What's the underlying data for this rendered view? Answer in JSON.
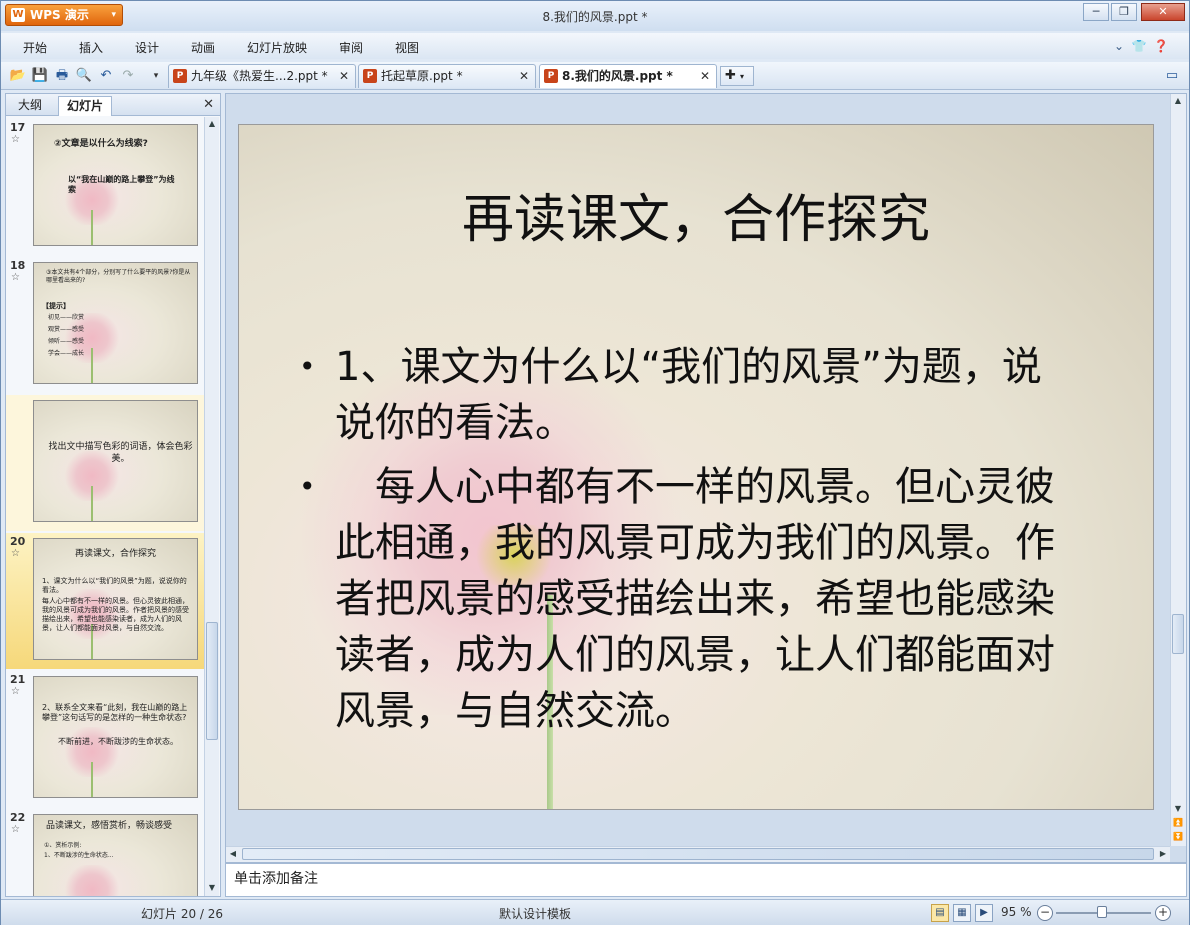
{
  "app": {
    "button_label": "WPS 演示",
    "window_title": "8.我们的风景.ppt *"
  },
  "menu": [
    "开始",
    "插入",
    "设计",
    "动画",
    "幻灯片放映",
    "审阅",
    "视图"
  ],
  "tabs": [
    {
      "label": "九年级《热爱生...2.ppt *"
    },
    {
      "label": "托起草原.ppt *"
    },
    {
      "label": "8.我们的风景.ppt *"
    }
  ],
  "left_pane": {
    "tab_outline": "大纲",
    "tab_slides": "幻灯片",
    "thumbs": [
      {
        "num": "17",
        "lines": [
          "②文章是以什么为线索?",
          "以“我在山巅的路上攀登”为线索"
        ]
      },
      {
        "num": "18",
        "lines": [
          "③本文共有4个部分，分别写了什么要平的风景?你是从哪里看出来的?",
          "【提示】",
          "初见——欣赏",
          "观赏——感受",
          "倾听——感受",
          "学会——成长"
        ]
      },
      {
        "num": "",
        "lines": [
          "找出文中描写色彩的词语，体会色彩美。"
        ]
      },
      {
        "num": "20",
        "lines": [
          "再读课文，合作探究",
          "1、课文为什么以“我们的风景”为题，说说你的看法。",
          "每人心中都有不一样的风景。但心灵彼此相通，我的风景可成为我们的风景。作者把风景的感受描绘出来，希望也能感染读者，成为人们的风景，让人们都能面对风景，与自然交流。"
        ]
      },
      {
        "num": "21",
        "lines": [
          "2、联系全文来看“此刻，我在山巅的路上攀登”这句话写的是怎样的一种生命状态?",
          "不断前进，不断跋涉的生命状态。"
        ]
      },
      {
        "num": "22",
        "lines": [
          "品读课文，感悟赏析，畅谈感受",
          "①、赏析示例:",
          "1、不断跋涉的生命状态..."
        ]
      }
    ]
  },
  "slide": {
    "title": "再读课文，合作探究",
    "bullets": [
      "1、课文为什么以“我们的风景”为题，说说你的看法。",
      "　每人心中都有不一样的风景。但心灵彼此相通，我的风景可成为我们的风景。作者把风景的感受描绘出来，希望也能感染读者，成为人们的风景，让人们都能面对风景，与自然交流。"
    ]
  },
  "notes_placeholder": "单击添加备注",
  "status": {
    "slide_index": "幻灯片 20 / 26",
    "template": "默认设计模板",
    "zoom": "95 %"
  }
}
